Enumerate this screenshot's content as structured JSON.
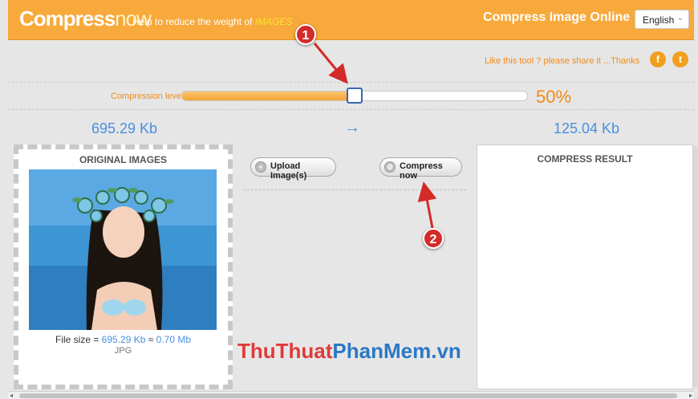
{
  "header": {
    "logo_part1": "Compress",
    "logo_part2": "now",
    "tagline": "Help to reduce the weight of ",
    "tagline_emphasis": "IMAGES",
    "site_title": "Compress Image Online",
    "language": "English"
  },
  "share": {
    "text": "Like this tool ? please share it ...Thanks",
    "facebook_glyph": "f",
    "twitter_glyph": "t"
  },
  "compression": {
    "label": "Compression level",
    "level_fraction": 0.5,
    "percent_text": "50%"
  },
  "sizes": {
    "original": "695.29 Kb",
    "arrow": "→",
    "compressed": "125.04 Kb"
  },
  "original_panel": {
    "title": "ORIGINAL IMAGES",
    "file_size_prefix": "File size = ",
    "file_size_kb": "695.29 Kb",
    "approx": " ≈ ",
    "file_size_mb": "0.70 Mb",
    "file_type": "JPG"
  },
  "actions": {
    "upload_label": "Upload Image(s)",
    "compress_label": "Compress now"
  },
  "result_panel": {
    "title": "COMPRESS RESULT"
  },
  "watermark": {
    "part1": "ThuThuat",
    "part2": "PhanMem.vn"
  },
  "callouts": {
    "one": "1",
    "two": "2"
  },
  "colors": {
    "brand_orange": "#f7a93b",
    "accent_blue": "#4a8fe0",
    "callout_red": "#d42a2a"
  }
}
